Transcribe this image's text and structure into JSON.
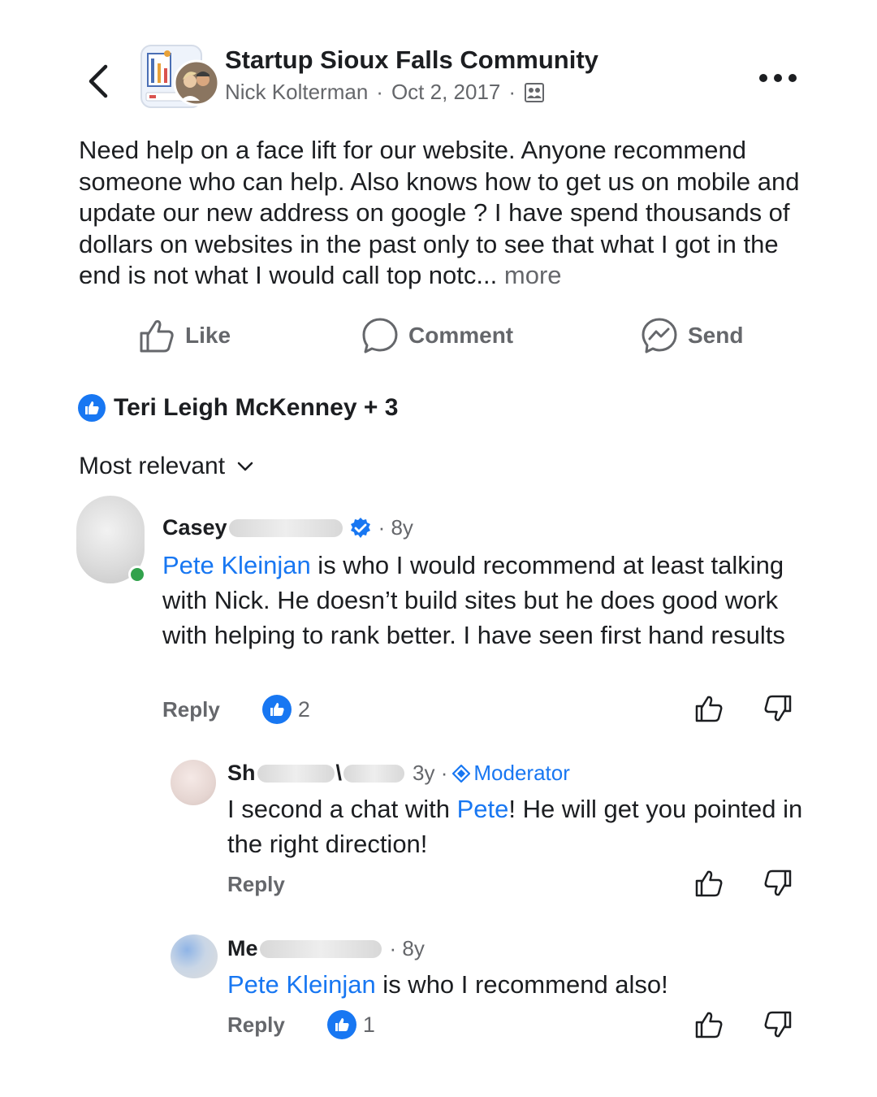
{
  "header": {
    "group_name": "Startup Sioux Falls Community",
    "author": "Nick Kolterman",
    "date": "Oct 2, 2017",
    "separator": "·"
  },
  "post": {
    "text": "Need help on a face lift for our website. Anyone recommend someone who can help. Also knows how to get us on mobile and update our new address on google ? I have spend thousands of dollars on websites in the past only to see that what I got in the end is not what I would call top notc...",
    "more_label": "more"
  },
  "actions": {
    "like": "Like",
    "comment": "Comment",
    "send": "Send"
  },
  "reactions": {
    "summary": "Teri Leigh McKenney + 3"
  },
  "sort": {
    "label": "Most relevant"
  },
  "comments": [
    {
      "name_start": "Casey",
      "time": "· 8y",
      "mention": "Pete Kleinjan",
      "text": " is who I would recommend at least talking with Nick. He doesn’t build sites but he does good work with helping to rank better. I have seen first hand results",
      "reply_label": "Reply",
      "like_count": "2"
    },
    {
      "name_start": "Sh",
      "time": "3y ·",
      "badge": "Moderator",
      "text_before": "I second a chat with ",
      "mention": "Pete",
      "text_after": "!  He will get you pointed in the right direction!",
      "reply_label": "Reply"
    },
    {
      "name_start": "Me",
      "time": "· 8y",
      "mention": "Pete Kleinjan",
      "text": " is who I recommend also!",
      "reply_label": "Reply",
      "like_count": "1"
    }
  ],
  "colors": {
    "accent": "#1877f2",
    "secondary_text": "#65676b",
    "online": "#31a24c"
  },
  "icons": [
    "back-chevron-icon",
    "more-icon",
    "members-icon",
    "like-icon",
    "comment-icon",
    "messenger-icon",
    "like-badge-icon",
    "chevron-down-icon",
    "verified-icon",
    "moderator-icon",
    "thumbs-up-icon",
    "thumbs-down-icon"
  ]
}
